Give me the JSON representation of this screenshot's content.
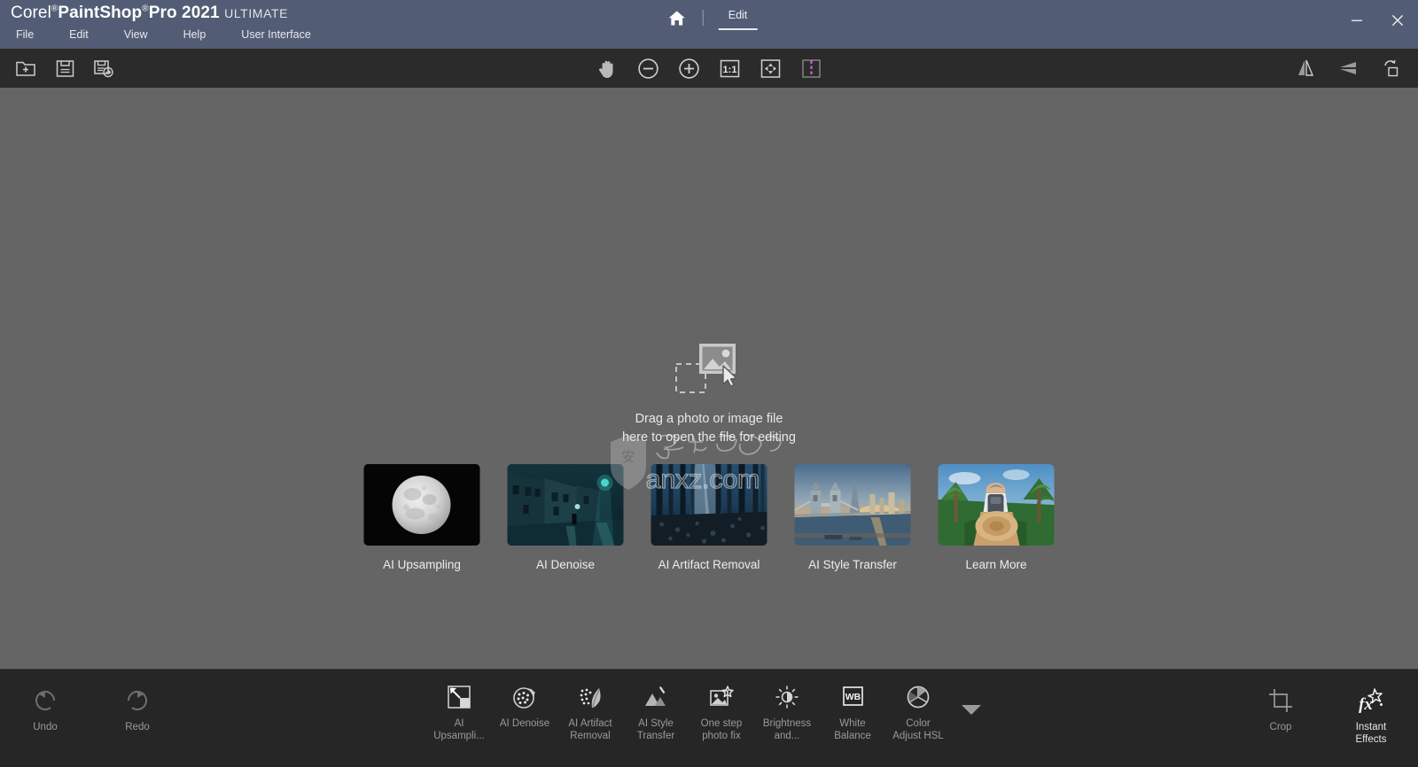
{
  "titlebar": {
    "brand_corel": "Corel",
    "brand_paintshop": "PaintShop",
    "brand_pro": "Pro 2021",
    "brand_edition": "ULTIMATE",
    "reg_mark": "®",
    "menu": [
      {
        "label": "File",
        "name": "menu-file"
      },
      {
        "label": "Edit",
        "name": "menu-edit"
      },
      {
        "label": "View",
        "name": "menu-view"
      },
      {
        "label": "Help",
        "name": "menu-help"
      },
      {
        "label": "User Interface",
        "name": "menu-user-interface"
      }
    ],
    "home_icon": "home-icon",
    "tab_edit": "Edit",
    "minimize": "–",
    "close": "✕",
    "bg_color": "#525d75"
  },
  "toolbar": {
    "left": [
      {
        "name": "new-image-button",
        "icon": "new-folder-plus-icon",
        "title": "New"
      },
      {
        "name": "save-button",
        "icon": "save-floppy-icon",
        "title": "Save"
      },
      {
        "name": "save-as-button",
        "icon": "save-as-floppy-arrow-icon",
        "title": "Save As"
      }
    ],
    "center": [
      {
        "name": "pan-tool-button",
        "icon": "hand-icon",
        "title": "Pan"
      },
      {
        "name": "zoom-out-button",
        "icon": "minus-circle-icon",
        "title": "Zoom Out"
      },
      {
        "name": "zoom-in-button",
        "icon": "plus-circle-icon",
        "title": "Zoom In"
      },
      {
        "name": "actual-size-button",
        "icon": "one-to-one-icon",
        "title": "1:1"
      },
      {
        "name": "fit-to-window-button",
        "icon": "fit-window-icon",
        "title": "Fit to Window"
      },
      {
        "name": "split-view-button",
        "icon": "split-view-icon",
        "title": "Split View"
      }
    ],
    "right": [
      {
        "name": "flip-horizontal-button",
        "icon": "mirror-horizontal-icon",
        "title": "Mirror"
      },
      {
        "name": "flip-vertical-button",
        "icon": "flip-vertical-icon",
        "title": "Flip"
      },
      {
        "name": "rotate-button",
        "icon": "rotate-icon",
        "title": "Rotate"
      }
    ],
    "one_to_one_label": "1:1",
    "bg_color": "#2b2b2b",
    "split_accent": "#c85ad0"
  },
  "canvas": {
    "bg_color": "#656565",
    "drop_icon": "drag-image-placeholder-icon",
    "drop_line1": "Drag a photo or image file",
    "drop_line2": "here to open the file for editing",
    "watermark_text": "anxz.com",
    "watermark_cn": "安下载"
  },
  "features": [
    {
      "name": "feature-ai-upsampling",
      "label": "AI Upsampling",
      "thumb": "moon-photo"
    },
    {
      "name": "feature-ai-denoise",
      "label": "AI Denoise",
      "thumb": "night-street-photo"
    },
    {
      "name": "feature-ai-artifact-removal",
      "label": "AI Artifact Removal",
      "thumb": "forest-photo"
    },
    {
      "name": "feature-ai-style-transfer",
      "label": "AI Style Transfer",
      "thumb": "tower-bridge-photo"
    },
    {
      "name": "feature-learn-more",
      "label": "Learn More",
      "thumb": "hiker-jungle-photo"
    }
  ],
  "bottombar": {
    "bg_color": "#262626",
    "left": [
      {
        "name": "undo-button",
        "label": "Undo",
        "icon": "undo-arrow-icon",
        "enabled": false
      },
      {
        "name": "redo-button",
        "label": "Redo",
        "icon": "redo-arrow-icon",
        "enabled": false
      }
    ],
    "center": [
      {
        "name": "tool-ai-upsampling",
        "label": "AI\nUpsampli...",
        "label_l1": "AI",
        "label_l2": "Upsampli...",
        "icon": "ai-upsampling-icon"
      },
      {
        "name": "tool-ai-denoise",
        "label": "AI Denoise",
        "label_l1": "AI Denoise",
        "label_l2": "",
        "icon": "ai-denoise-icon"
      },
      {
        "name": "tool-ai-artifact-removal",
        "label": "AI Artifact Removal",
        "label_l1": "AI Artifact",
        "label_l2": "Removal",
        "icon": "ai-artifact-removal-icon"
      },
      {
        "name": "tool-ai-style-transfer",
        "label": "AI Style Transfer",
        "label_l1": "AI Style",
        "label_l2": "Transfer",
        "icon": "ai-style-transfer-icon"
      },
      {
        "name": "tool-one-step-photo-fix",
        "label": "One step photo fix",
        "label_l1": "One step",
        "label_l2": "photo fix",
        "icon": "one-step-photo-fix-icon"
      },
      {
        "name": "tool-brightness",
        "label": "Brightness and...",
        "label_l1": "Brightness",
        "label_l2": "and...",
        "icon": "brightness-sun-icon"
      },
      {
        "name": "tool-white-balance",
        "label": "White Balance",
        "label_l1": "White",
        "label_l2": "Balance",
        "icon": "white-balance-icon",
        "icon_text": "WB"
      },
      {
        "name": "tool-color-adjust-hsl",
        "label": "Color Adjust HSL",
        "label_l1": "Color",
        "label_l2": "Adjust HSL",
        "icon": "color-adjust-hsl-icon"
      }
    ],
    "expand": {
      "name": "expand-more-button",
      "icon": "chevron-down-icon"
    },
    "right": [
      {
        "name": "tool-crop",
        "label": "Crop",
        "icon": "crop-icon",
        "active": false
      },
      {
        "name": "tool-instant-effects",
        "label_l1": "Instant",
        "label_l2": "Effects",
        "label": "Instant Effects",
        "icon": "instant-effects-fx-icon",
        "active": true
      }
    ]
  }
}
